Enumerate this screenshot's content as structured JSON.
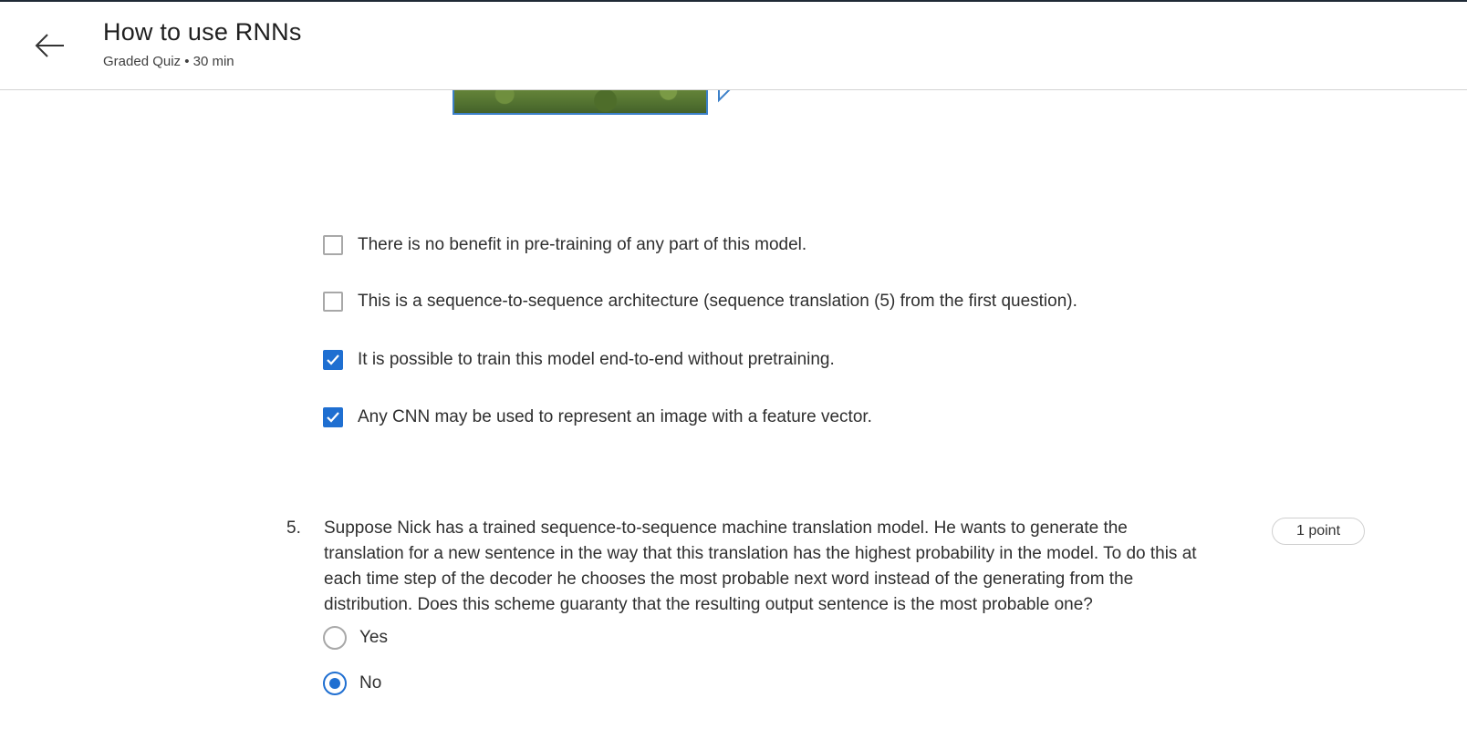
{
  "header": {
    "title": "How to use RNNs",
    "subtitle": "Graded Quiz • 30 min",
    "back_icon": "arrow-left-icon"
  },
  "question4": {
    "options": [
      {
        "label": "There is no benefit in pre-training of any part of this model.",
        "checked": false
      },
      {
        "label": "This is a sequence-to-sequence architecture (sequence translation (5) from the first question).",
        "checked": false
      },
      {
        "label": "It is possible to train this model end-to-end without pretraining.",
        "checked": true
      },
      {
        "label": "Any CNN may be used to represent an image with a feature vector.",
        "checked": true
      }
    ]
  },
  "question5": {
    "number": "5.",
    "text": "Suppose Nick has a trained sequence-to-sequence machine translation model. He wants to generate the translation for a new sentence in the way that this translation has the highest probability in the model. To do this at each time step of the decoder he chooses the most probable next word instead of the generating from the distribution. Does this scheme guaranty that the resulting output sentence is the most probable one?",
    "points": "1 point",
    "options": [
      {
        "label": "Yes",
        "selected": false
      },
      {
        "label": "No",
        "selected": true
      }
    ]
  },
  "colors": {
    "accent": "#1f6fd1",
    "text": "#2f2f2f",
    "border": "#a8a8a8"
  }
}
